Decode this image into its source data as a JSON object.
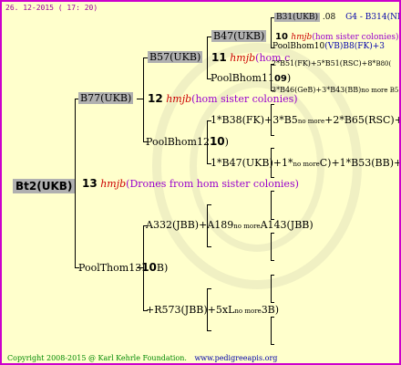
{
  "header": {
    "date": "26. 12-2015 ( 17: 20)"
  },
  "footer": {
    "copyright": "Copyright 2008-2015 @ Karl Kehrle Foundation.",
    "site": "www.pedigreeapis.org"
  },
  "colors": {
    "border": "#cc00cc",
    "background": "#ffffcc",
    "breeder": "#cc0000",
    "note": "#9900cc",
    "box": "#b0b0b0"
  },
  "root": {
    "id": "Bt2(UKB)",
    "gen": "13",
    "breeder": "hmjb",
    "note": "(Drones from hom sister colonies)"
  },
  "sire": {
    "id": "B77(UKB)",
    "gen": "12",
    "breeder": "hmjb",
    "note": "(hom sister colonies)"
  },
  "dam": {
    "id": "PoolThom13",
    "gen": "10",
    "suffix": "B)"
  },
  "ss": {
    "id": "B57(UKB)",
    "gen": "11",
    "breeder": "hmjb",
    "note": "(hom c"
  },
  "sd": {
    "id": "PoolBhom12",
    "gen": "10",
    "suffix": ")"
  },
  "ds": {
    "text": "A332(JBB)+A189",
    "mid": "no more",
    "end": "A143(JBB)"
  },
  "dd": {
    "text": "+R573(JBB)+5xL",
    "mid": "no more",
    "end": "3B)"
  },
  "sss": {
    "id": "B47(UKB)",
    "gen": "10",
    "breeder": "hmjb",
    "note": "(hom sister colonies)"
  },
  "ssd": {
    "id": "PoolBhom11",
    "gen": "09",
    "suffix": ")"
  },
  "sds": {
    "text": "1*B38(FK)+3*B5",
    "mid": "no more",
    "end": "+2*B65(RSC)+3*B3"
  },
  "sdd": {
    "text": "1*B47(UKB)+1*",
    "mid": "no more",
    "end": "C)+1*B53(BB)+1*"
  },
  "ssss": {
    "id": "B31(UKB)",
    "gen": ".08",
    "extra": "G4 - B314(NE)"
  },
  "sssd": {
    "text": "PoolBhom10",
    "over": "(VB)B8(FK)+3"
  },
  "ssds": {
    "text": "2*B51(FK)+5*B51(RSC)+8*",
    "tail": "B80("
  },
  "ssdd": {
    "text": "3*B46(GeB)+3*B43(BB)",
    "tail": "no more B5("
  }
}
